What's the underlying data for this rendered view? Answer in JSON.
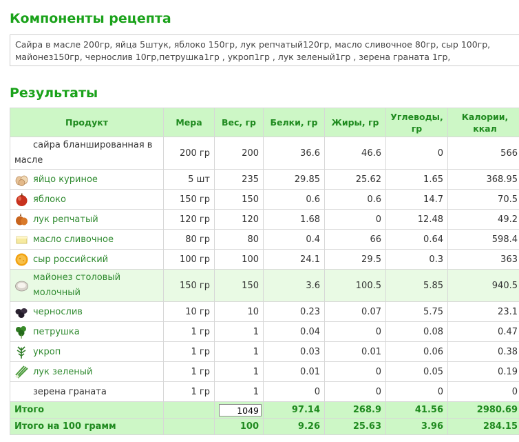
{
  "page": {
    "components_title": "Компоненты рецепта",
    "ingredients_text": "Сайра в масле 200гр, яйца 5штук, яблоко 150гр, лук репчатый120гр, масло сливочное 80гр, сыр 100гр, майонез150гр, чернослив 10гр,петрушка1гр , укроп1гр , лук зеленый1гр , зерена граната 1гр,",
    "results_title": "Результаты"
  },
  "table": {
    "headers": [
      "Продукт",
      "Мера",
      "Вес, гр",
      "Белки, гр",
      "Жиры, гр",
      "Углеводы, гр",
      "Калории, ккал"
    ],
    "rows": [
      {
        "product": "сайра бланшированная в масле",
        "measure": "200 гр",
        "weight": "200",
        "protein": "36.6",
        "fat": "46.6",
        "carbs": "0",
        "kcal": "566",
        "icon": "none"
      },
      {
        "product": "яйцо куриное",
        "measure": "5 шт",
        "weight": "235",
        "protein": "29.85",
        "fat": "25.62",
        "carbs": "1.65",
        "kcal": "368.95",
        "icon": "eggs-icon"
      },
      {
        "product": "яблоко",
        "measure": "150 гр",
        "weight": "150",
        "protein": "0.6",
        "fat": "0.6",
        "carbs": "14.7",
        "kcal": "70.5",
        "icon": "apple-icon"
      },
      {
        "product": "лук репчатый",
        "measure": "120 гр",
        "weight": "120",
        "protein": "1.68",
        "fat": "0",
        "carbs": "12.48",
        "kcal": "49.2",
        "icon": "onion-icon"
      },
      {
        "product": "масло сливочное",
        "measure": "80 гр",
        "weight": "80",
        "protein": "0.4",
        "fat": "66",
        "carbs": "0.64",
        "kcal": "598.4",
        "icon": "butter-icon"
      },
      {
        "product": "сыр российский",
        "measure": "100 гр",
        "weight": "100",
        "protein": "24.1",
        "fat": "29.5",
        "carbs": "0.3",
        "kcal": "363",
        "icon": "cheese-icon"
      },
      {
        "product": "майонез столовый молочный",
        "measure": "150 гр",
        "weight": "150",
        "protein": "3.6",
        "fat": "100.5",
        "carbs": "5.85",
        "kcal": "940.5",
        "icon": "mayonnaise-icon"
      },
      {
        "product": "чернослив",
        "measure": "10 гр",
        "weight": "10",
        "protein": "0.23",
        "fat": "0.07",
        "carbs": "5.75",
        "kcal": "23.1",
        "icon": "prunes-icon"
      },
      {
        "product": "петрушка",
        "measure": "1 гр",
        "weight": "1",
        "protein": "0.04",
        "fat": "0",
        "carbs": "0.08",
        "kcal": "0.47",
        "icon": "parsley-icon"
      },
      {
        "product": "укроп",
        "measure": "1 гр",
        "weight": "1",
        "protein": "0.03",
        "fat": "0.01",
        "carbs": "0.06",
        "kcal": "0.38",
        "icon": "dill-icon"
      },
      {
        "product": "лук зеленый",
        "measure": "1 гр",
        "weight": "1",
        "protein": "0.01",
        "fat": "0",
        "carbs": "0.05",
        "kcal": "0.19",
        "icon": "green-onion-icon"
      },
      {
        "product": "зерена граната",
        "measure": "1 гр",
        "weight": "1",
        "protein": "0",
        "fat": "0",
        "carbs": "0",
        "kcal": "0",
        "icon": "none"
      }
    ],
    "total": {
      "label": "Итого",
      "weight": "1049",
      "protein": "97.14",
      "fat": "268.9",
      "carbs": "41.56",
      "kcal": "2980.69"
    },
    "per100": {
      "label": "Итого на 100 грамм",
      "weight": "100",
      "protein": "9.26",
      "fat": "25.63",
      "carbs": "3.96",
      "kcal": "284.15"
    }
  },
  "colors": {
    "accent": "#1aa21a",
    "header_bg": "#cdf7c6",
    "highlight_row": "#e9fae4"
  }
}
